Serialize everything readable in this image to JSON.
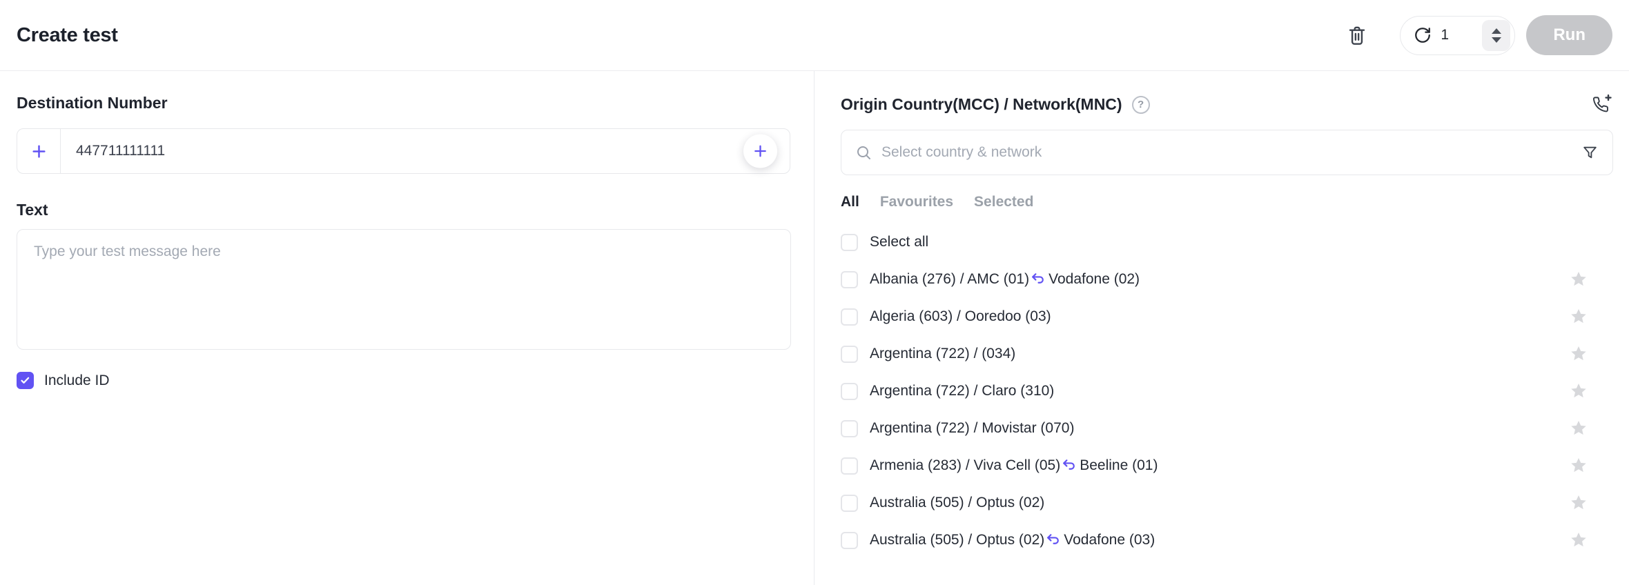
{
  "header": {
    "title": "Create test",
    "repeat_count": "1",
    "run_label": "Run"
  },
  "destination": {
    "label": "Destination Number",
    "value": "447711111111"
  },
  "message": {
    "label": "Text",
    "placeholder": "Type your test message here"
  },
  "include_id": {
    "label": "Include ID",
    "checked": true
  },
  "origin": {
    "title": "Origin Country(MCC) / Network(MNC)",
    "help_glyph": "?",
    "search_placeholder": "Select country & network",
    "tabs": [
      {
        "label": "All",
        "active": true
      },
      {
        "label": "Favourites",
        "active": false
      },
      {
        "label": "Selected",
        "active": false
      }
    ],
    "select_all_label": "Select all",
    "rows": [
      {
        "primary": "Albania (276) / AMC (01)",
        "fallback": "Vodafone (02)"
      },
      {
        "primary": "Algeria (603) / Ooredoo (03)"
      },
      {
        "primary": "Argentina (722) / (034)"
      },
      {
        "primary": "Argentina (722) / Claro (310)"
      },
      {
        "primary": "Argentina (722) / Movistar (070)"
      },
      {
        "primary": "Armenia (283) / Viva Cell (05)",
        "fallback": "Beeline (01)"
      },
      {
        "primary": "Australia (505) / Optus (02)"
      },
      {
        "primary": "Australia (505) / Optus (02)",
        "fallback": "Vodafone (03)"
      }
    ]
  },
  "icons": {
    "header": [
      "trash-icon",
      "rotate-cw-icon",
      "stepper-up-icon",
      "stepper-down-icon"
    ],
    "left": [
      "plus-icon",
      "plus-circle-icon",
      "checkmark-icon"
    ],
    "right": [
      "question-circle-icon",
      "phone-plus-icon",
      "search-icon",
      "filter-funnel-icon",
      "fallback-arrow-icon",
      "star-icon"
    ]
  },
  "colors": {
    "accent": "#6152f3",
    "run_button_bg": "#c6c7ca",
    "star_gray": "#d7d8db",
    "border_gray": "#e7e8eb",
    "text_dark": "#21252f",
    "text_muted": "#a3a9b3"
  }
}
